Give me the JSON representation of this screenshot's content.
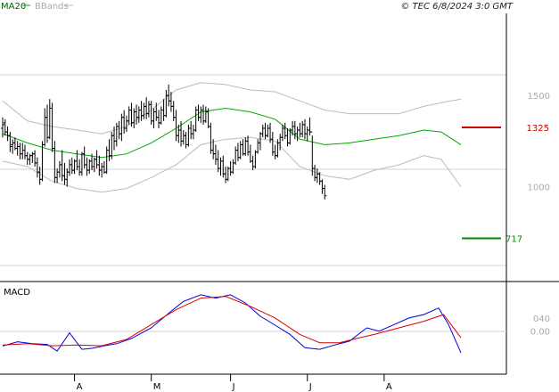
{
  "header": {
    "ma_label": "MA20",
    "bb_label": "BBands",
    "source": "© TEC 6/8/2024 3:0 GMT",
    "ma_color": "#00aa00",
    "bb_color": "#bbbbbb"
  },
  "macd_title": "MACD",
  "levels": {
    "resistance": {
      "value": 1325,
      "label": "1325",
      "color": "#cc0000"
    },
    "support": {
      "value": 717,
      "label": "717",
      "color": "#008800"
    }
  },
  "chart_data": {
    "type": "line",
    "price_axis": {
      "ticks": [
        1500,
        1000
      ],
      "tick_labels": [
        "1500",
        "1000"
      ],
      "ylim": [
        480,
        1950
      ]
    },
    "macd_axis": {
      "ticks": [
        40,
        0
      ],
      "tick_labels": [
        "040",
        "0.00"
      ],
      "ylim": [
        -130,
        150
      ]
    },
    "x_labels": [
      "A",
      "M",
      "J",
      "J",
      "A"
    ],
    "x_label_index": [
      29,
      60,
      92,
      123,
      154
    ],
    "ohlc_bars": [
      [
        1320,
        1380,
        1270,
        1340
      ],
      [
        1350,
        1370,
        1280,
        1300
      ],
      [
        1300,
        1330,
        1250,
        1280
      ],
      [
        1280,
        1300,
        1190,
        1220
      ],
      [
        1230,
        1260,
        1180,
        1240
      ],
      [
        1240,
        1270,
        1200,
        1210
      ],
      [
        1210,
        1250,
        1170,
        1220
      ],
      [
        1220,
        1240,
        1150,
        1180
      ],
      [
        1180,
        1240,
        1150,
        1200
      ],
      [
        1200,
        1230,
        1150,
        1170
      ],
      [
        1170,
        1190,
        1120,
        1150
      ],
      [
        1150,
        1180,
        1120,
        1170
      ],
      [
        1170,
        1190,
        1130,
        1180
      ],
      [
        1180,
        1200,
        1110,
        1130
      ],
      [
        1130,
        1160,
        1050,
        1080
      ],
      [
        1080,
        1110,
        1010,
        1040
      ],
      [
        1040,
        1250,
        1030,
        1230
      ],
      [
        1230,
        1430,
        1220,
        1380
      ],
      [
        1380,
        1450,
        1240,
        1270
      ],
      [
        1270,
        1480,
        1260,
        1430
      ],
      [
        1430,
        1460,
        1190,
        1210
      ],
      [
        1210,
        1250,
        1020,
        1050
      ],
      [
        1050,
        1100,
        1020,
        1080
      ],
      [
        1080,
        1140,
        1050,
        1120
      ],
      [
        1120,
        1200,
        1030,
        1060
      ],
      [
        1060,
        1130,
        1010,
        1040
      ],
      [
        1040,
        1100,
        1000,
        1080
      ],
      [
        1080,
        1150,
        1060,
        1120
      ],
      [
        1120,
        1160,
        1070,
        1090
      ],
      [
        1090,
        1150,
        1070,
        1140
      ],
      [
        1140,
        1200,
        1090,
        1110
      ],
      [
        1110,
        1150,
        1060,
        1080
      ],
      [
        1080,
        1190,
        1060,
        1180
      ],
      [
        1180,
        1220,
        1100,
        1120
      ],
      [
        1120,
        1160,
        1060,
        1090
      ],
      [
        1090,
        1150,
        1070,
        1140
      ],
      [
        1140,
        1180,
        1090,
        1110
      ],
      [
        1110,
        1160,
        1080,
        1150
      ],
      [
        1150,
        1200,
        1100,
        1120
      ],
      [
        1120,
        1170,
        1060,
        1090
      ],
      [
        1090,
        1130,
        1050,
        1110
      ],
      [
        1110,
        1140,
        1070,
        1080
      ],
      [
        1080,
        1220,
        1070,
        1200
      ],
      [
        1200,
        1260,
        1140,
        1170
      ],
      [
        1170,
        1300,
        1150,
        1280
      ],
      [
        1280,
        1330,
        1200,
        1250
      ],
      [
        1250,
        1350,
        1220,
        1330
      ],
      [
        1330,
        1360,
        1260,
        1290
      ],
      [
        1290,
        1400,
        1250,
        1380
      ],
      [
        1380,
        1420,
        1290,
        1320
      ],
      [
        1320,
        1390,
        1300,
        1360
      ],
      [
        1360,
        1440,
        1340,
        1420
      ],
      [
        1420,
        1460,
        1330,
        1350
      ],
      [
        1350,
        1430,
        1320,
        1410
      ],
      [
        1410,
        1450,
        1340,
        1380
      ],
      [
        1380,
        1440,
        1350,
        1420
      ],
      [
        1420,
        1470,
        1360,
        1390
      ],
      [
        1390,
        1460,
        1370,
        1440
      ],
      [
        1440,
        1490,
        1370,
        1400
      ],
      [
        1400,
        1470,
        1380,
        1450
      ],
      [
        1450,
        1470,
        1340,
        1360
      ],
      [
        1360,
        1430,
        1320,
        1410
      ],
      [
        1410,
        1460,
        1360,
        1380
      ],
      [
        1380,
        1420,
        1320,
        1350
      ],
      [
        1350,
        1440,
        1340,
        1420
      ],
      [
        1420,
        1480,
        1360,
        1390
      ],
      [
        1390,
        1530,
        1380,
        1500
      ],
      [
        1500,
        1560,
        1440,
        1470
      ],
      [
        1470,
        1520,
        1410,
        1440
      ],
      [
        1440,
        1470,
        1360,
        1380
      ],
      [
        1380,
        1420,
        1250,
        1280
      ],
      [
        1280,
        1340,
        1240,
        1310
      ],
      [
        1310,
        1360,
        1220,
        1250
      ],
      [
        1250,
        1310,
        1230,
        1280
      ],
      [
        1280,
        1300,
        1210,
        1230
      ],
      [
        1230,
        1340,
        1220,
        1320
      ],
      [
        1320,
        1360,
        1260,
        1290
      ],
      [
        1290,
        1340,
        1260,
        1310
      ],
      [
        1310,
        1440,
        1300,
        1420
      ],
      [
        1420,
        1450,
        1360,
        1380
      ],
      [
        1380,
        1440,
        1350,
        1420
      ],
      [
        1420,
        1450,
        1340,
        1360
      ],
      [
        1360,
        1440,
        1350,
        1410
      ],
      [
        1410,
        1430,
        1320,
        1330
      ],
      [
        1330,
        1350,
        1180,
        1200
      ],
      [
        1200,
        1260,
        1150,
        1180
      ],
      [
        1180,
        1230,
        1120,
        1150
      ],
      [
        1150,
        1200,
        1080,
        1100
      ],
      [
        1100,
        1160,
        1060,
        1140
      ],
      [
        1140,
        1170,
        1050,
        1070
      ],
      [
        1070,
        1110,
        1020,
        1040
      ],
      [
        1040,
        1110,
        1030,
        1100
      ],
      [
        1100,
        1140,
        1060,
        1080
      ],
      [
        1080,
        1150,
        1070,
        1130
      ],
      [
        1130,
        1220,
        1120,
        1200
      ],
      [
        1200,
        1240,
        1140,
        1160
      ],
      [
        1160,
        1250,
        1150,
        1230
      ],
      [
        1230,
        1260,
        1170,
        1180
      ],
      [
        1180,
        1270,
        1170,
        1250
      ],
      [
        1250,
        1280,
        1170,
        1190
      ],
      [
        1190,
        1230,
        1130,
        1140
      ],
      [
        1140,
        1170,
        1090,
        1110
      ],
      [
        1110,
        1200,
        1100,
        1190
      ],
      [
        1190,
        1260,
        1180,
        1240
      ],
      [
        1240,
        1300,
        1200,
        1290
      ],
      [
        1290,
        1340,
        1270,
        1320
      ],
      [
        1320,
        1350,
        1260,
        1280
      ],
      [
        1280,
        1340,
        1270,
        1320
      ],
      [
        1320,
        1350,
        1240,
        1260
      ],
      [
        1260,
        1300,
        1170,
        1190
      ],
      [
        1190,
        1230,
        1150,
        1170
      ],
      [
        1170,
        1260,
        1160,
        1240
      ],
      [
        1240,
        1290,
        1200,
        1270
      ],
      [
        1270,
        1340,
        1250,
        1320
      ],
      [
        1320,
        1350,
        1260,
        1280
      ],
      [
        1280,
        1320,
        1220,
        1240
      ],
      [
        1240,
        1320,
        1230,
        1310
      ],
      [
        1310,
        1360,
        1280,
        1330
      ],
      [
        1330,
        1360,
        1260,
        1290
      ],
      [
        1290,
        1330,
        1250,
        1310
      ],
      [
        1310,
        1350,
        1270,
        1290
      ],
      [
        1290,
        1360,
        1270,
        1340
      ],
      [
        1340,
        1370,
        1260,
        1290
      ],
      [
        1290,
        1330,
        1250,
        1310
      ],
      [
        1310,
        1380,
        1280,
        1300
      ],
      [
        1300,
        1280,
        1060,
        1100
      ],
      [
        1100,
        1120,
        1030,
        1050
      ],
      [
        1050,
        1100,
        1020,
        1070
      ],
      [
        1070,
        1080,
        1010,
        1030
      ],
      [
        1030,
        1040,
        960,
        990
      ],
      [
        990,
        1010,
        930,
        950
      ]
    ],
    "series": [
      {
        "name": "MA20",
        "color": "#00aa00",
        "points": [
          [
            0,
            1290
          ],
          [
            10,
            1240
          ],
          [
            20,
            1200
          ],
          [
            30,
            1180
          ],
          [
            40,
            1160
          ],
          [
            50,
            1180
          ],
          [
            60,
            1240
          ],
          [
            70,
            1320
          ],
          [
            80,
            1410
          ],
          [
            90,
            1430
          ],
          [
            100,
            1410
          ],
          [
            110,
            1370
          ],
          [
            120,
            1260
          ],
          [
            130,
            1230
          ],
          [
            140,
            1240
          ],
          [
            150,
            1260
          ],
          [
            160,
            1280
          ],
          [
            170,
            1310
          ],
          [
            177,
            1300
          ],
          [
            185,
            1230
          ]
        ]
      },
      {
        "name": "BBands",
        "color": "#bbbbbb",
        "points": [
          [
            0,
            1470
          ],
          [
            10,
            1360
          ],
          [
            20,
            1330
          ],
          [
            30,
            1310
          ],
          [
            40,
            1290
          ],
          [
            50,
            1330
          ],
          [
            60,
            1420
          ],
          [
            70,
            1530
          ],
          [
            80,
            1570
          ],
          [
            90,
            1560
          ],
          [
            100,
            1530
          ],
          [
            110,
            1520
          ],
          [
            120,
            1470
          ],
          [
            130,
            1420
          ],
          [
            140,
            1400
          ],
          [
            150,
            1400
          ],
          [
            160,
            1400
          ],
          [
            170,
            1440
          ],
          [
            177,
            1460
          ],
          [
            185,
            1480
          ]
        ]
      },
      {
        "color": "#bbbbbb",
        "points": [
          [
            0,
            1140
          ],
          [
            10,
            1110
          ],
          [
            20,
            1030
          ],
          [
            30,
            990
          ],
          [
            40,
            970
          ],
          [
            50,
            990
          ],
          [
            60,
            1050
          ],
          [
            70,
            1120
          ],
          [
            80,
            1230
          ],
          [
            90,
            1260
          ],
          [
            100,
            1270
          ],
          [
            110,
            1250
          ],
          [
            120,
            1110
          ],
          [
            130,
            1060
          ],
          [
            140,
            1040
          ],
          [
            150,
            1090
          ],
          [
            160,
            1120
          ],
          [
            170,
            1170
          ],
          [
            177,
            1150
          ],
          [
            185,
            1000
          ]
        ]
      },
      {
        "name": "MACD",
        "panel": "macd",
        "color": "#0000dd",
        "points": [
          [
            0,
            -45
          ],
          [
            6,
            -32
          ],
          [
            12,
            -38
          ],
          [
            18,
            -40
          ],
          [
            22,
            -60
          ],
          [
            27,
            -5
          ],
          [
            32,
            -55
          ],
          [
            36,
            -52
          ],
          [
            41,
            -44
          ],
          [
            46,
            -38
          ],
          [
            52,
            -22
          ],
          [
            60,
            10
          ],
          [
            68,
            60
          ],
          [
            73,
            90
          ],
          [
            80,
            110
          ],
          [
            86,
            100
          ],
          [
            92,
            110
          ],
          [
            98,
            85
          ],
          [
            104,
            45
          ],
          [
            110,
            18
          ],
          [
            116,
            -10
          ],
          [
            122,
            -50
          ],
          [
            128,
            -55
          ],
          [
            134,
            -42
          ],
          [
            140,
            -30
          ],
          [
            147,
            10
          ],
          [
            152,
            0
          ],
          [
            158,
            20
          ],
          [
            164,
            40
          ],
          [
            170,
            50
          ],
          [
            176,
            70
          ],
          [
            180,
            20
          ],
          [
            185,
            -65
          ]
        ]
      },
      {
        "name": "Signal",
        "panel": "macd",
        "color": "#dd0000",
        "points": [
          [
            0,
            -42
          ],
          [
            10,
            -38
          ],
          [
            20,
            -44
          ],
          [
            30,
            -42
          ],
          [
            40,
            -44
          ],
          [
            50,
            -25
          ],
          [
            60,
            20
          ],
          [
            70,
            65
          ],
          [
            80,
            100
          ],
          [
            90,
            105
          ],
          [
            100,
            75
          ],
          [
            110,
            40
          ],
          [
            120,
            -10
          ],
          [
            128,
            -35
          ],
          [
            136,
            -35
          ],
          [
            144,
            -20
          ],
          [
            150,
            -10
          ],
          [
            160,
            10
          ],
          [
            170,
            30
          ],
          [
            178,
            50
          ],
          [
            185,
            -20
          ]
        ]
      }
    ]
  }
}
